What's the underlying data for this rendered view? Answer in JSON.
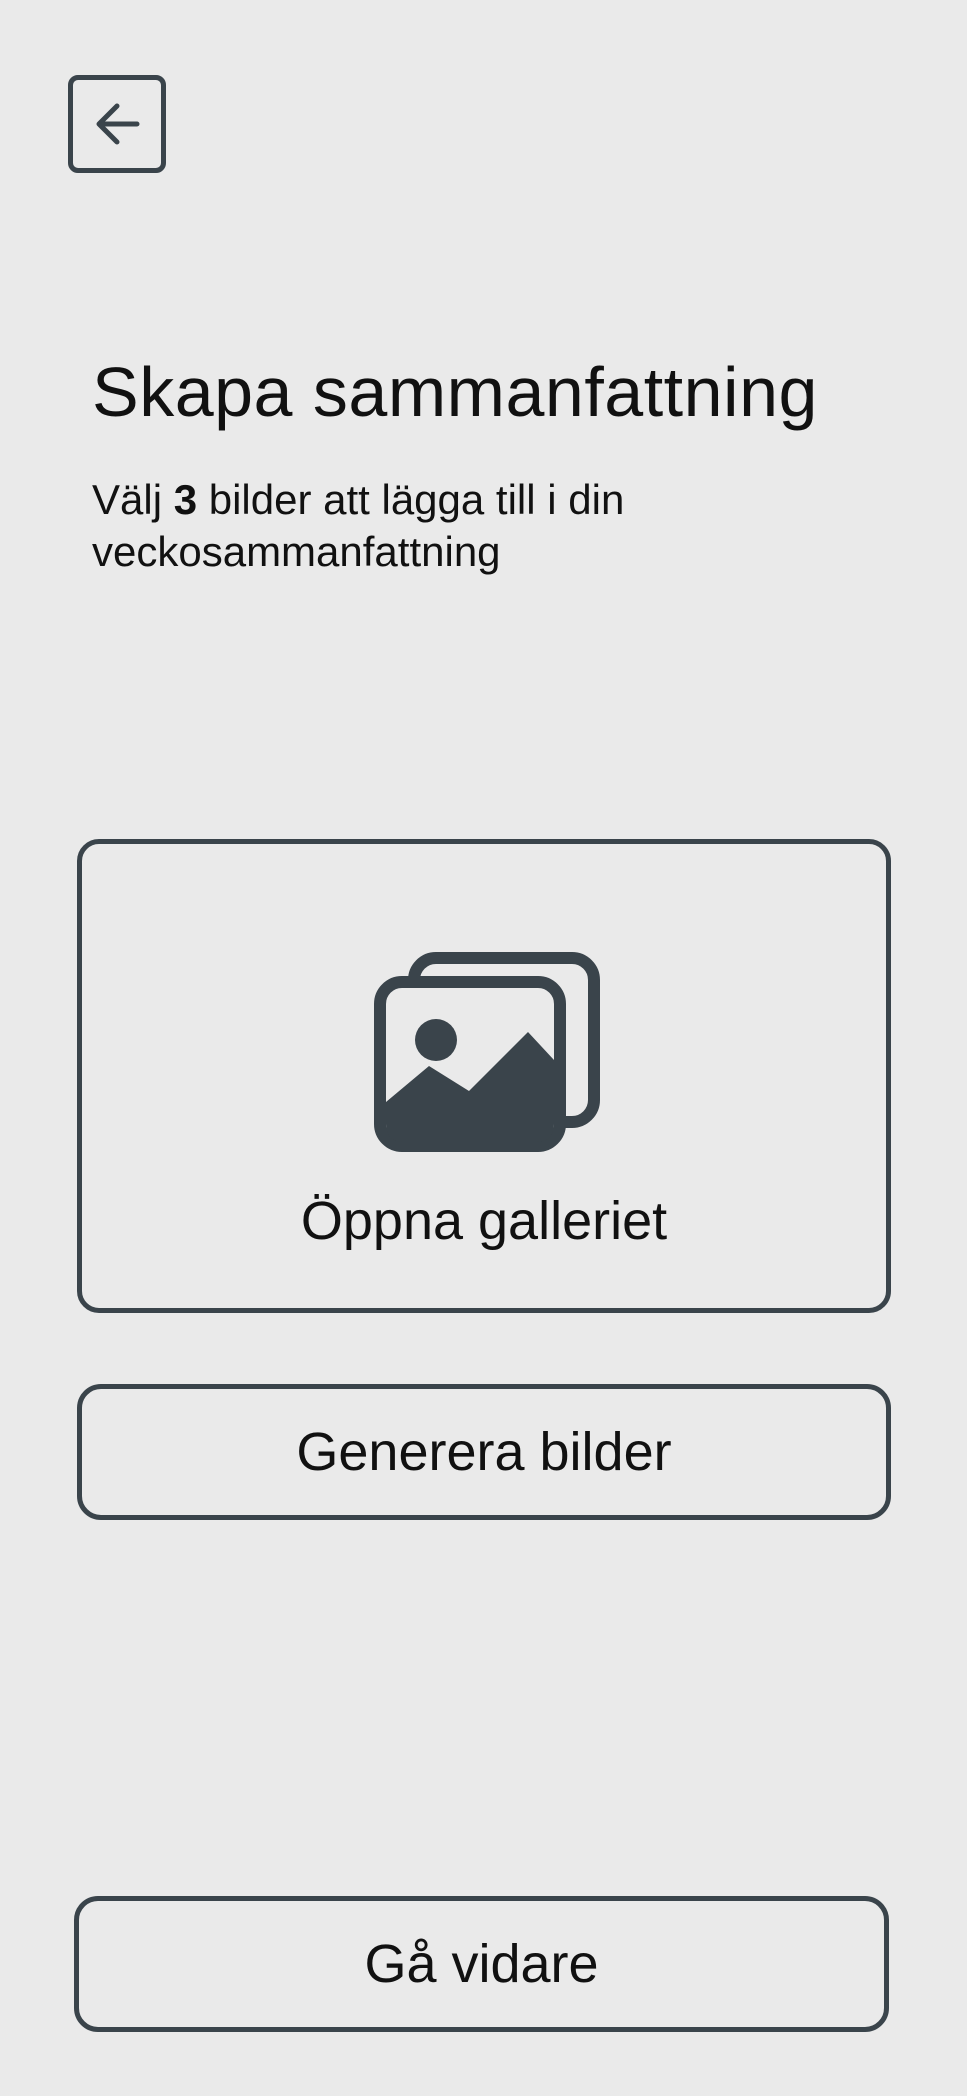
{
  "header": {
    "back_icon": "arrow-left-icon"
  },
  "main": {
    "title": "Skapa sammanfattning",
    "subtitle_prefix": "Välj ",
    "subtitle_count": "3",
    "subtitle_suffix": " bilder att lägga till i din veckosammanfattning"
  },
  "gallery": {
    "icon": "images-icon",
    "label": "Öppna galleriet"
  },
  "actions": {
    "generate_label": "Generera bilder",
    "continue_label": "Gå vidare"
  },
  "colors": {
    "background": "#eaeaea",
    "outline": "#3a444b",
    "text": "#111111"
  }
}
